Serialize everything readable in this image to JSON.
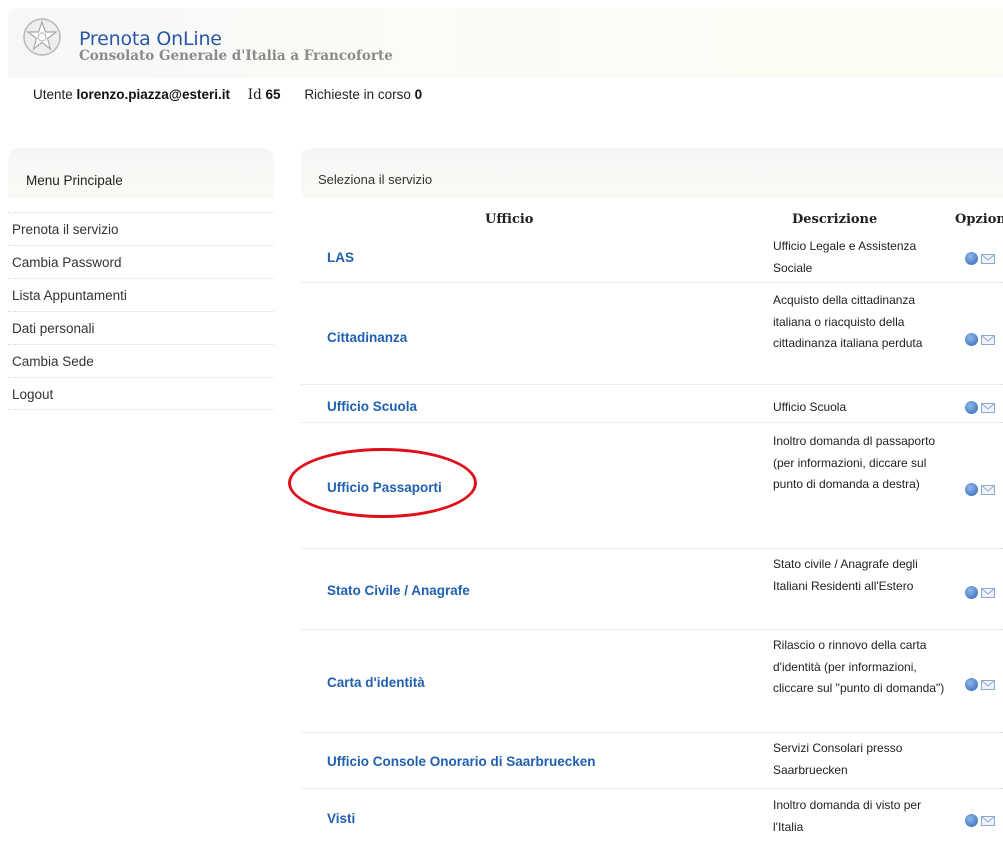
{
  "header": {
    "title": "Prenota OnLine",
    "subtitle": "Consolato Generale d'Italia a Francoforte",
    "logo_icon": "italian-emblem-icon"
  },
  "user": {
    "user_label": "Utente",
    "email": "lorenzo.piazza@esteri.it",
    "id_label": "Id",
    "id_value": "65",
    "requests_label": "Richieste in corso",
    "requests_value": "0"
  },
  "sidebar": {
    "title": "Menu Principale",
    "items": [
      {
        "label": "Prenota il servizio"
      },
      {
        "label": "Cambia Password"
      },
      {
        "label": "Lista Appuntamenti"
      },
      {
        "label": "Dati personali"
      },
      {
        "label": "Cambia Sede"
      },
      {
        "label": "Logout"
      }
    ]
  },
  "main": {
    "title": "Seleziona il servizio",
    "columns": {
      "ufficio": "Ufficio",
      "descrizione": "Descrizione",
      "opzioni": "Opzioni"
    },
    "rows": [
      {
        "ufficio": "LAS",
        "descrizione": "Ufficio Legale e Assistenza Sociale",
        "options": [
          "help-icon",
          "mail-icon"
        ]
      },
      {
        "ufficio": "Cittadinanza",
        "descrizione": "Acquisto della cittadinanza italiana o riacquisto della cittadinanza italiana perduta",
        "options": [
          "help-icon",
          "mail-icon"
        ]
      },
      {
        "ufficio": "Ufficio Scuola",
        "descrizione": "Ufficio Scuola",
        "options": [
          "help-icon",
          "mail-icon"
        ]
      },
      {
        "ufficio": "Ufficio Passaporti",
        "descrizione": "Inoltro domanda dl passaporto (per informazioni, diccare sul punto di domanda a destra)",
        "options": [
          "help-icon",
          "mail-icon"
        ]
      },
      {
        "ufficio": "Stato Civile / Anagrafe",
        "descrizione": "Stato civile / Anagrafe degli Italiani Residenti all'Estero",
        "options": [
          "help-icon",
          "mail-icon"
        ]
      },
      {
        "ufficio": "Carta d'identità",
        "descrizione": "Rilascio o rinnovo della carta d'identità (per informazioni, cliccare sul \"punto di domanda\")",
        "options": [
          "help-icon",
          "mail-icon"
        ]
      },
      {
        "ufficio": "Ufficio Console Onorario di Saarbruecken",
        "descrizione": "Servizi Consolari presso Saarbruecken",
        "options": []
      },
      {
        "ufficio": "Visti",
        "descrizione": "Inoltro domanda di visto per l'Italia",
        "options": [
          "help-icon",
          "mail-icon"
        ]
      }
    ]
  },
  "colors": {
    "link": "#2060b0",
    "title": "#2a57a8",
    "highlight": "#e0101a"
  }
}
